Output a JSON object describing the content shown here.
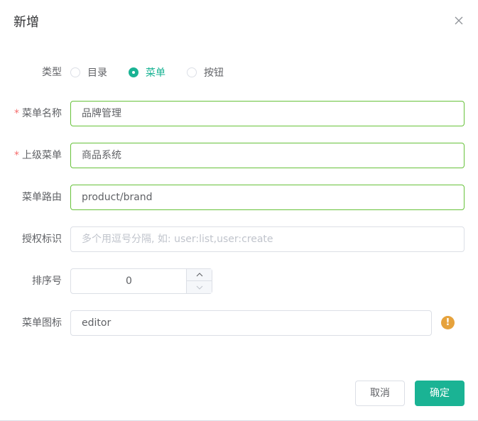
{
  "dialog": {
    "title": "新增"
  },
  "form": {
    "type": {
      "label": "类型",
      "options": [
        "目录",
        "菜单",
        "按钮"
      ],
      "selected": "菜单"
    },
    "menu_name": {
      "required": "*",
      "label": "菜单名称",
      "value": "品牌管理"
    },
    "parent_menu": {
      "required": "*",
      "label": "上级菜单",
      "value": "商品系统"
    },
    "menu_route": {
      "label": "菜单路由",
      "value": "product/brand"
    },
    "permission": {
      "label": "授权标识",
      "value": "",
      "placeholder": "多个用逗号分隔, 如: user:list,user:create"
    },
    "sort_order": {
      "label": "排序号",
      "value": "0"
    },
    "menu_icon": {
      "label": "菜单图标",
      "value": "editor",
      "status_icon": "warning-icon",
      "status_symbol": "!"
    }
  },
  "footer": {
    "cancel_label": "取消",
    "confirm_label": "确定"
  },
  "colors": {
    "accent": "#1ab394",
    "valid_border": "#67c23a",
    "warning": "#e6a23c",
    "required": "#f56c6c"
  }
}
